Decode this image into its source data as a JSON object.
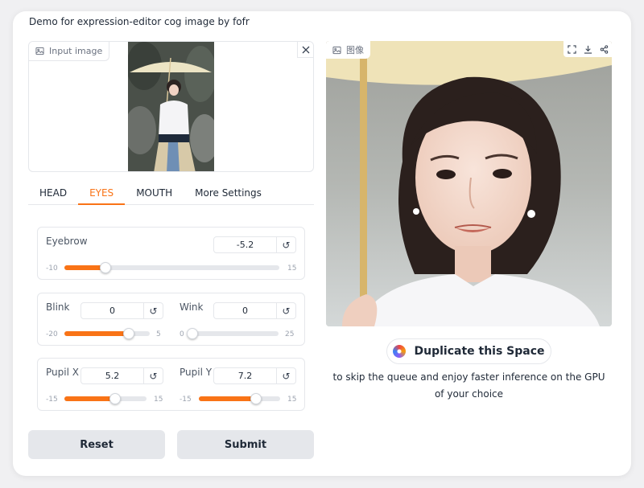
{
  "demo_title": "Demo for expression-editor cog image by fofr",
  "input_image": {
    "label": "Input image"
  },
  "tabs": [
    {
      "label": "HEAD",
      "active": false
    },
    {
      "label": "EYES",
      "active": true
    },
    {
      "label": "MOUTH",
      "active": false
    },
    {
      "label": "More Settings",
      "active": false
    }
  ],
  "sliders": {
    "eyebrow": {
      "label": "Eyebrow",
      "value": "-5.2",
      "min": "-10",
      "max": "15",
      "fraction": 0.19
    },
    "blink": {
      "label": "Blink",
      "value": "0",
      "min": "-20",
      "max": "5",
      "fraction": 0.75
    },
    "wink": {
      "label": "Wink",
      "value": "0",
      "min": "0",
      "max": "25",
      "fraction": 0.0
    },
    "pupil_x": {
      "label": "Pupil X",
      "value": "5.2",
      "min": "-15",
      "max": "15",
      "fraction": 0.62
    },
    "pupil_y": {
      "label": "Pupil Y",
      "value": "7.2",
      "min": "-15",
      "max": "15",
      "fraction": 0.7
    }
  },
  "buttons": {
    "reset": "Reset",
    "submit": "Submit"
  },
  "output_image": {
    "label": "图像"
  },
  "duplicate": {
    "button_label": "Duplicate this Space",
    "text": "to skip the queue and enjoy faster inference on the GPU of your choice"
  },
  "colors": {
    "accent": "#f97316",
    "button_bg": "#e5e7eb"
  }
}
